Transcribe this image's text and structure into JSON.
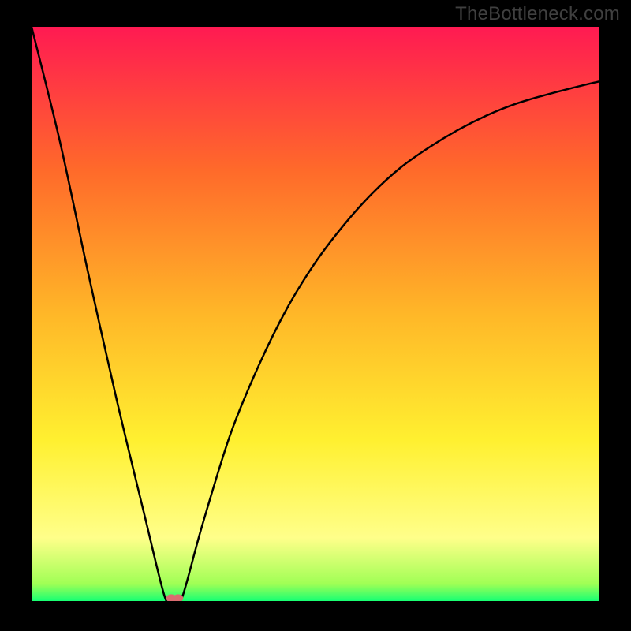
{
  "watermark": "TheBottleneck.com",
  "colors": {
    "frame": "#000000",
    "watermark": "#404040",
    "gradient_top": "#ff1a52",
    "gradient_mid_upper": "#ff6a2a",
    "gradient_mid": "#ffb728",
    "gradient_mid_lower": "#fff030",
    "gradient_lower_yellow": "#ffff8a",
    "gradient_bottom": "#17ff73",
    "curve": "#000000",
    "marker": "#db6b70"
  },
  "chart_data": {
    "type": "line",
    "title": "",
    "xlabel": "",
    "ylabel": "",
    "xlim": [
      0,
      100
    ],
    "ylim": [
      0,
      100
    ],
    "series": [
      {
        "name": "bottleneck-curve",
        "x": [
          0,
          5,
          10,
          15,
          20,
          23.5,
          25,
          26.5,
          30,
          35,
          40,
          45,
          50,
          55,
          60,
          65,
          70,
          75,
          80,
          85,
          90,
          95,
          100
        ],
        "values": [
          100,
          80,
          57,
          35,
          14.5,
          0.6,
          0,
          0.6,
          13,
          29,
          41,
          51,
          59,
          65.5,
          71,
          75.5,
          79,
          82,
          84.5,
          86.5,
          88,
          89.3,
          90.5
        ]
      }
    ],
    "markers": [
      {
        "name": "min-point-a",
        "x": 24.6,
        "y": 0.5
      },
      {
        "name": "min-point-b",
        "x": 25.8,
        "y": 0.5
      }
    ],
    "gradient_stops": [
      {
        "pct": 0,
        "color": "#ff1a52"
      },
      {
        "pct": 25,
        "color": "#ff6a2a"
      },
      {
        "pct": 50,
        "color": "#ffb728"
      },
      {
        "pct": 72,
        "color": "#fff030"
      },
      {
        "pct": 89,
        "color": "#ffff8a"
      },
      {
        "pct": 97,
        "color": "#a0ff55"
      },
      {
        "pct": 100,
        "color": "#17ff73"
      }
    ]
  }
}
